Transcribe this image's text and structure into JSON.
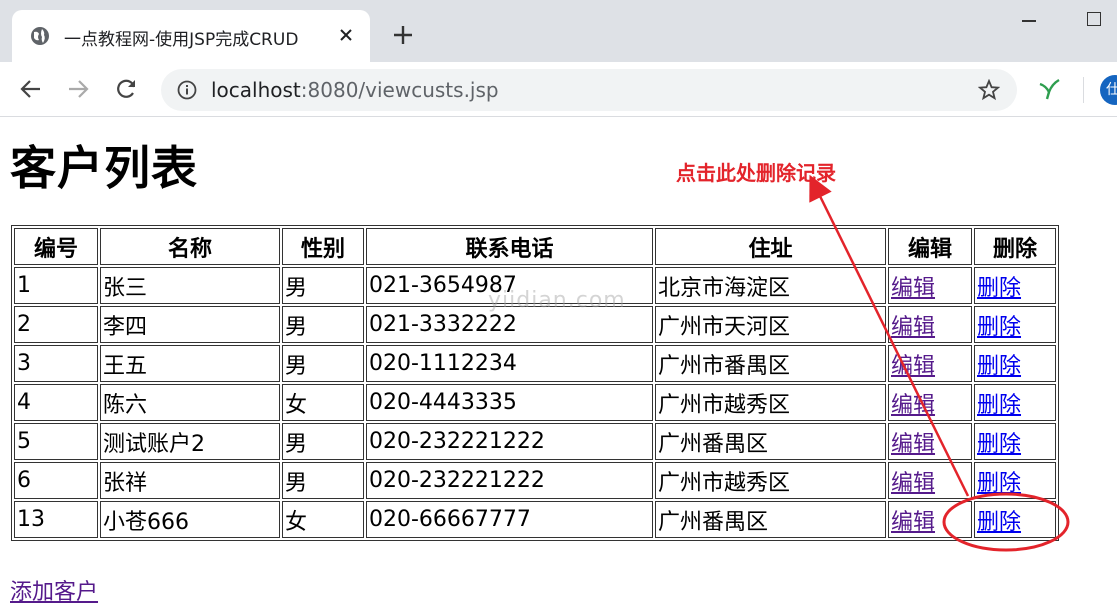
{
  "browser": {
    "tab_title": "一点教程网-使用JSP完成CRUD",
    "url_host": "localhost",
    "url_rest": ":8080/viewcusts.jsp",
    "avatar_text": "仕"
  },
  "page": {
    "title": "客户列表",
    "annotation": "点击此处删除记录",
    "add_link": "添加客户",
    "watermark": "yiidian.com"
  },
  "table": {
    "headers": [
      "编号",
      "名称",
      "性别",
      "联系电话",
      "住址",
      "编辑",
      "删除"
    ],
    "rows": [
      {
        "id": "1",
        "name": "张三",
        "gender": "男",
        "phone": "021-3654987",
        "address": "北京市海淀区",
        "edit": "编辑",
        "delete": "删除"
      },
      {
        "id": "2",
        "name": "李四",
        "gender": "男",
        "phone": "021-3332222",
        "address": "广州市天河区",
        "edit": "编辑",
        "delete": "删除"
      },
      {
        "id": "3",
        "name": "王五",
        "gender": "男",
        "phone": "020-1112234",
        "address": "广州市番禺区",
        "edit": "编辑",
        "delete": "删除"
      },
      {
        "id": "4",
        "name": "陈六",
        "gender": "女",
        "phone": "020-4443335",
        "address": "广州市越秀区",
        "edit": "编辑",
        "delete": "删除"
      },
      {
        "id": "5",
        "name": "测试账户2",
        "gender": "男",
        "phone": "020-232221222",
        "address": "广州番禺区",
        "edit": "编辑",
        "delete": "删除"
      },
      {
        "id": "6",
        "name": "张祥",
        "gender": "男",
        "phone": "020-232221222",
        "address": "广州市越秀区",
        "edit": "编辑",
        "delete": "删除"
      },
      {
        "id": "13",
        "name": "小苍666",
        "gender": "女",
        "phone": "020-66667777",
        "address": "广州番禺区",
        "edit": "编辑",
        "delete": "删除"
      }
    ]
  },
  "colors": {
    "annotation_red": "#e3242b",
    "visited_link": "#551a8b",
    "unvisited_link": "#0000ee"
  }
}
